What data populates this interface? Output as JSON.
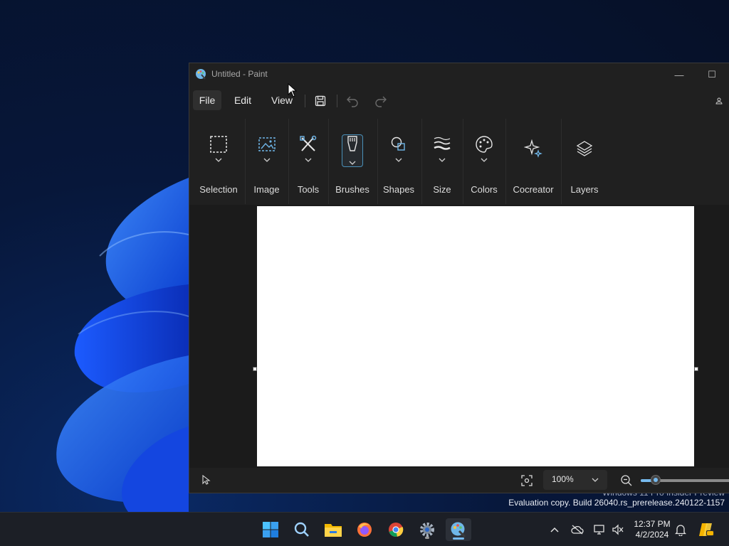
{
  "window": {
    "title": "Untitled - Paint",
    "min_glyph": "—",
    "max_glyph": "☐"
  },
  "menu": {
    "file": "File",
    "edit": "Edit",
    "view": "View"
  },
  "ribbon": {
    "groups": [
      {
        "label": "Selection",
        "icon": "selection-icon"
      },
      {
        "label": "Image",
        "icon": "image-icon"
      },
      {
        "label": "Tools",
        "icon": "tools-icon"
      },
      {
        "label": "Brushes",
        "icon": "brush-icon",
        "selected": true
      },
      {
        "label": "Shapes",
        "icon": "shapes-icon"
      },
      {
        "label": "Size",
        "icon": "size-icon"
      },
      {
        "label": "Colors",
        "icon": "palette-icon"
      },
      {
        "label": "Cocreator",
        "icon": "sparkle-icon"
      },
      {
        "label": "Layers",
        "icon": "layers-icon"
      }
    ]
  },
  "statusbar": {
    "zoom": "100%",
    "zoom_slider_fraction": 0.15
  },
  "watermark": {
    "line1": "Windows 11 Pro Insider Preview",
    "line2": "Evaluation copy. Build 26040.rs_prerelease.240122-1157"
  },
  "taskbar": {
    "apps": [
      "windows-start-icon",
      "search-icon",
      "file-explorer-icon",
      "firefox-icon",
      "chrome-icon",
      "settings-icon",
      "paint-icon"
    ],
    "clock": {
      "time": "12:37 PM",
      "date": "4/2/2024"
    }
  },
  "colors": {
    "accent": "#76b9ed",
    "window_bg": "#202020",
    "canvas_bg": "#ffffff"
  }
}
